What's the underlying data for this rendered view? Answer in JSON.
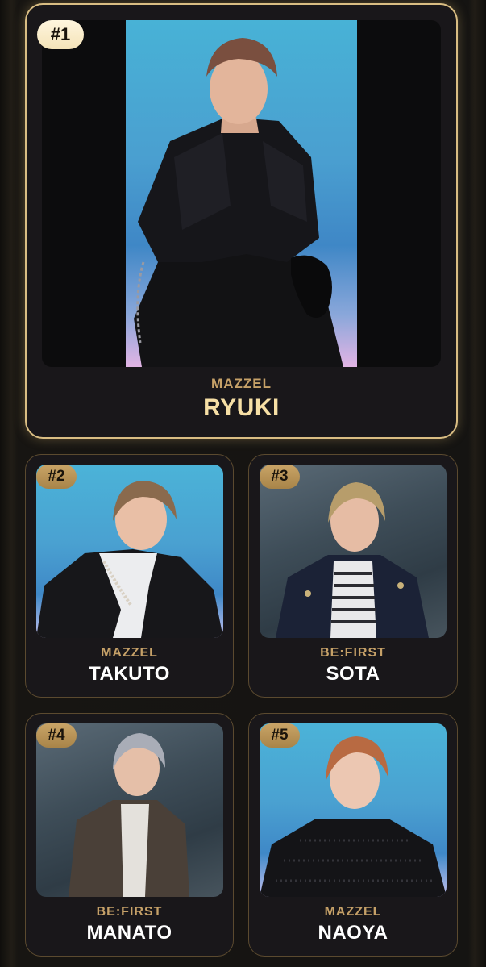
{
  "top_pick": {
    "rank": "#1",
    "group": "MAZZEL",
    "name": "RYUKI"
  },
  "ranking": [
    {
      "rank": "#2",
      "group": "MAZZEL",
      "name": "TAKUTO"
    },
    {
      "rank": "#3",
      "group": "BE:FIRST",
      "name": "SOTA"
    },
    {
      "rank": "#4",
      "group": "BE:FIRST",
      "name": "MANATO"
    },
    {
      "rank": "#5",
      "group": "MAZZEL",
      "name": "NAOYA"
    }
  ],
  "colors": {
    "accent_gold": "#c6a168",
    "top_name_gold": "#f6dfa5",
    "card_background": "#19171a",
    "card_border": "#5b4a2f",
    "top_card_border": "#d9bd83"
  }
}
